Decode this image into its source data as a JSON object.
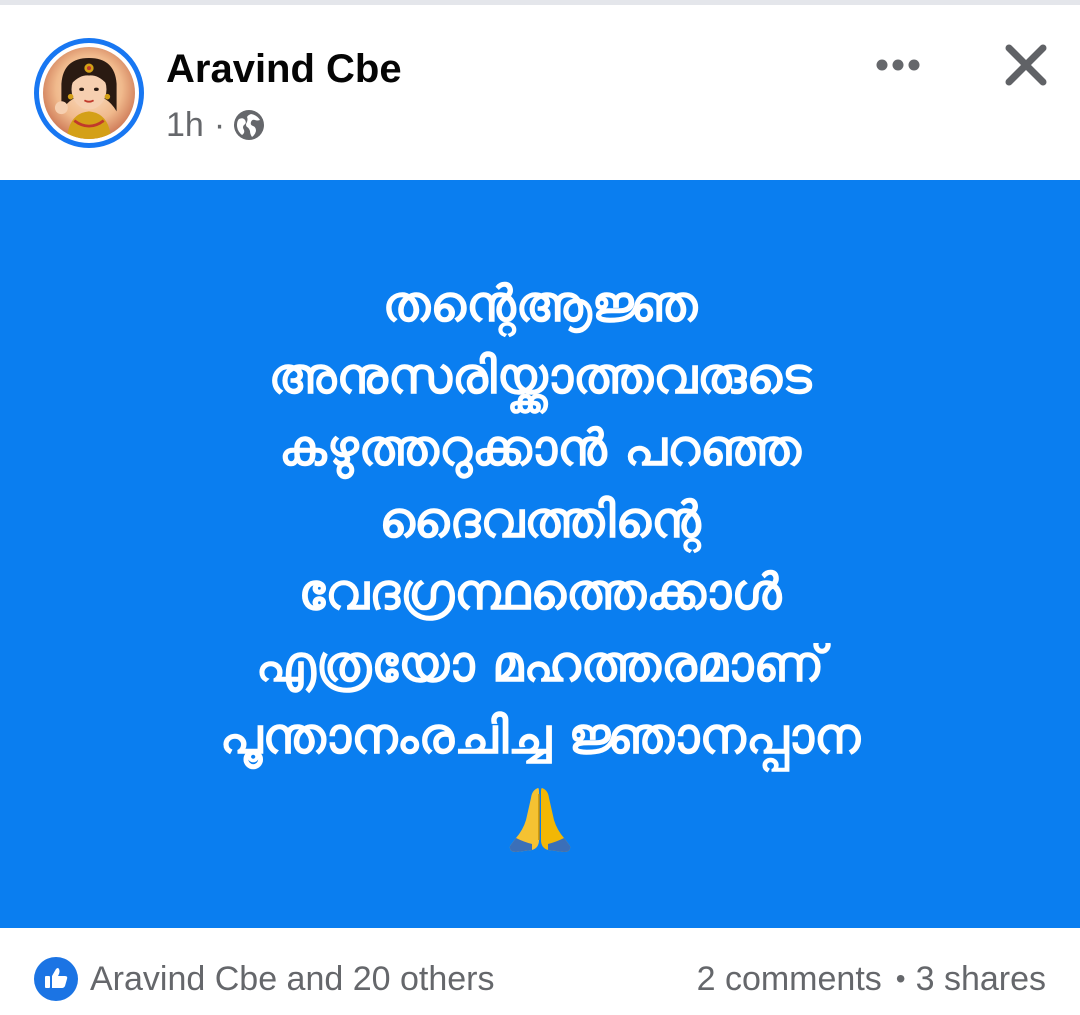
{
  "post": {
    "author": {
      "name": "Aravind Cbe",
      "avatar_icon": "profile-photo-avatar"
    },
    "time": "1h",
    "separator": "·",
    "audience_icon": "globe-icon",
    "actions": {
      "more_label": "•••",
      "close_label": "✕"
    },
    "body": {
      "background_color": "#0a7ef0",
      "text_color": "#ffffff",
      "lines": [
        "തന്റെആജ്ഞ",
        "അനുസരിയ്ക്കാത്തവരുടെ",
        "കഴുത്തറുക്കാൻ പറഞ്ഞ",
        "ദൈവത്തിന്റെ",
        "വേദഗ്രന്ഥത്തെക്കാൾ",
        "എത്രയോ മഹത്തരമാണ്",
        "പൂന്താനംരചിച്ച ജ്ഞാനപ്പാന"
      ],
      "emoji": "🙏",
      "emoji_icon": "folded-hands-icon"
    },
    "footer": {
      "like_icon": "thumbs-up-icon",
      "reactions_text": "Aravind Cbe and 20 others",
      "comments_text": "2 comments",
      "stats_separator": "•",
      "shares_text": "3 shares"
    }
  },
  "colors": {
    "accent": "#1877f2",
    "meta_text": "#65676b",
    "name_text": "#050505"
  }
}
